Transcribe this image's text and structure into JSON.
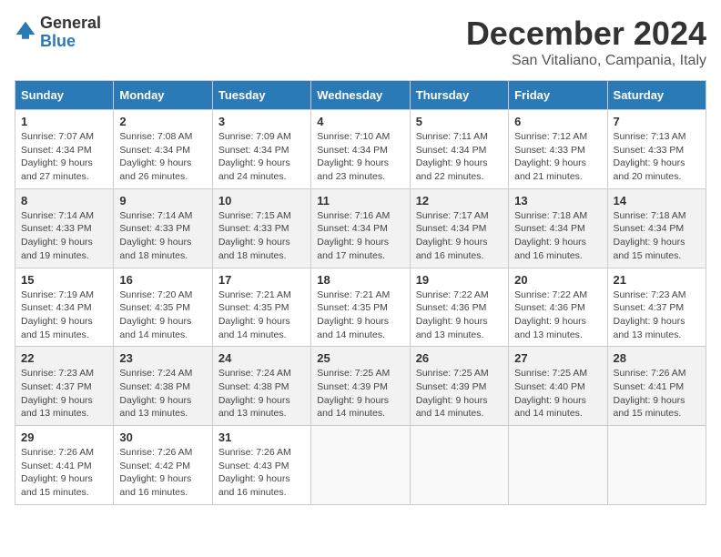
{
  "logo": {
    "text_general": "General",
    "text_blue": "Blue"
  },
  "header": {
    "month": "December 2024",
    "location": "San Vitaliano, Campania, Italy"
  },
  "weekdays": [
    "Sunday",
    "Monday",
    "Tuesday",
    "Wednesday",
    "Thursday",
    "Friday",
    "Saturday"
  ],
  "weeks": [
    [
      {
        "day": "1",
        "sunrise": "7:07 AM",
        "sunset": "4:34 PM",
        "daylight": "9 hours and 27 minutes."
      },
      {
        "day": "2",
        "sunrise": "7:08 AM",
        "sunset": "4:34 PM",
        "daylight": "9 hours and 26 minutes."
      },
      {
        "day": "3",
        "sunrise": "7:09 AM",
        "sunset": "4:34 PM",
        "daylight": "9 hours and 24 minutes."
      },
      {
        "day": "4",
        "sunrise": "7:10 AM",
        "sunset": "4:34 PM",
        "daylight": "9 hours and 23 minutes."
      },
      {
        "day": "5",
        "sunrise": "7:11 AM",
        "sunset": "4:34 PM",
        "daylight": "9 hours and 22 minutes."
      },
      {
        "day": "6",
        "sunrise": "7:12 AM",
        "sunset": "4:33 PM",
        "daylight": "9 hours and 21 minutes."
      },
      {
        "day": "7",
        "sunrise": "7:13 AM",
        "sunset": "4:33 PM",
        "daylight": "9 hours and 20 minutes."
      }
    ],
    [
      {
        "day": "8",
        "sunrise": "7:14 AM",
        "sunset": "4:33 PM",
        "daylight": "9 hours and 19 minutes."
      },
      {
        "day": "9",
        "sunrise": "7:14 AM",
        "sunset": "4:33 PM",
        "daylight": "9 hours and 18 minutes."
      },
      {
        "day": "10",
        "sunrise": "7:15 AM",
        "sunset": "4:33 PM",
        "daylight": "9 hours and 18 minutes."
      },
      {
        "day": "11",
        "sunrise": "7:16 AM",
        "sunset": "4:34 PM",
        "daylight": "9 hours and 17 minutes."
      },
      {
        "day": "12",
        "sunrise": "7:17 AM",
        "sunset": "4:34 PM",
        "daylight": "9 hours and 16 minutes."
      },
      {
        "day": "13",
        "sunrise": "7:18 AM",
        "sunset": "4:34 PM",
        "daylight": "9 hours and 16 minutes."
      },
      {
        "day": "14",
        "sunrise": "7:18 AM",
        "sunset": "4:34 PM",
        "daylight": "9 hours and 15 minutes."
      }
    ],
    [
      {
        "day": "15",
        "sunrise": "7:19 AM",
        "sunset": "4:34 PM",
        "daylight": "9 hours and 15 minutes."
      },
      {
        "day": "16",
        "sunrise": "7:20 AM",
        "sunset": "4:35 PM",
        "daylight": "9 hours and 14 minutes."
      },
      {
        "day": "17",
        "sunrise": "7:21 AM",
        "sunset": "4:35 PM",
        "daylight": "9 hours and 14 minutes."
      },
      {
        "day": "18",
        "sunrise": "7:21 AM",
        "sunset": "4:35 PM",
        "daylight": "9 hours and 14 minutes."
      },
      {
        "day": "19",
        "sunrise": "7:22 AM",
        "sunset": "4:36 PM",
        "daylight": "9 hours and 13 minutes."
      },
      {
        "day": "20",
        "sunrise": "7:22 AM",
        "sunset": "4:36 PM",
        "daylight": "9 hours and 13 minutes."
      },
      {
        "day": "21",
        "sunrise": "7:23 AM",
        "sunset": "4:37 PM",
        "daylight": "9 hours and 13 minutes."
      }
    ],
    [
      {
        "day": "22",
        "sunrise": "7:23 AM",
        "sunset": "4:37 PM",
        "daylight": "9 hours and 13 minutes."
      },
      {
        "day": "23",
        "sunrise": "7:24 AM",
        "sunset": "4:38 PM",
        "daylight": "9 hours and 13 minutes."
      },
      {
        "day": "24",
        "sunrise": "7:24 AM",
        "sunset": "4:38 PM",
        "daylight": "9 hours and 13 minutes."
      },
      {
        "day": "25",
        "sunrise": "7:25 AM",
        "sunset": "4:39 PM",
        "daylight": "9 hours and 14 minutes."
      },
      {
        "day": "26",
        "sunrise": "7:25 AM",
        "sunset": "4:39 PM",
        "daylight": "9 hours and 14 minutes."
      },
      {
        "day": "27",
        "sunrise": "7:25 AM",
        "sunset": "4:40 PM",
        "daylight": "9 hours and 14 minutes."
      },
      {
        "day": "28",
        "sunrise": "7:26 AM",
        "sunset": "4:41 PM",
        "daylight": "9 hours and 15 minutes."
      }
    ],
    [
      {
        "day": "29",
        "sunrise": "7:26 AM",
        "sunset": "4:41 PM",
        "daylight": "9 hours and 15 minutes."
      },
      {
        "day": "30",
        "sunrise": "7:26 AM",
        "sunset": "4:42 PM",
        "daylight": "9 hours and 16 minutes."
      },
      {
        "day": "31",
        "sunrise": "7:26 AM",
        "sunset": "4:43 PM",
        "daylight": "9 hours and 16 minutes."
      },
      null,
      null,
      null,
      null
    ]
  ]
}
